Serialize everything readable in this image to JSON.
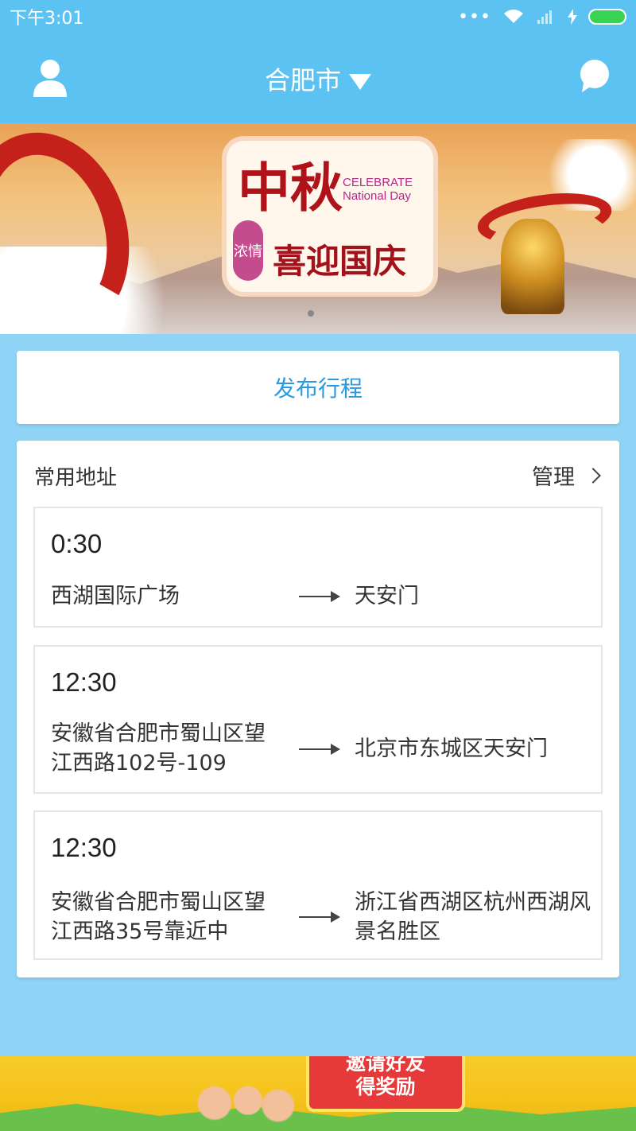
{
  "status_bar": {
    "time": "下午3:01"
  },
  "header": {
    "city": "合肥市",
    "icons": [
      "user-icon",
      "chevron-down-icon",
      "message-icon"
    ]
  },
  "banner": {
    "headline": "中秋",
    "sub_headline": "喜迎国庆",
    "side_text": "浓情",
    "english": "CELEBRATE National Day",
    "page_index": 1,
    "page_count": 1
  },
  "publish": {
    "label": "发布行程"
  },
  "addresses": {
    "title": "常用地址",
    "manage_label": "管理",
    "routes": [
      {
        "time": "0:30",
        "from": "西湖国际广场",
        "to": "天安门"
      },
      {
        "time": "12:30",
        "from": "安徽省合肥市蜀山区望江西路102号-109",
        "to": "北京市东城区天安门"
      },
      {
        "time": "12:30",
        "from": "安徽省合肥市蜀山区望江西路35号靠近中",
        "to": "浙江省西湖区杭州西湖风景名胜区"
      }
    ]
  },
  "invite": {
    "line1": "邀请好友",
    "line2": "得奖励"
  },
  "colors": {
    "primary": "#5bc2f2",
    "background": "#8fd4f7",
    "link": "#2a9ae0",
    "battery": "#39d353"
  }
}
